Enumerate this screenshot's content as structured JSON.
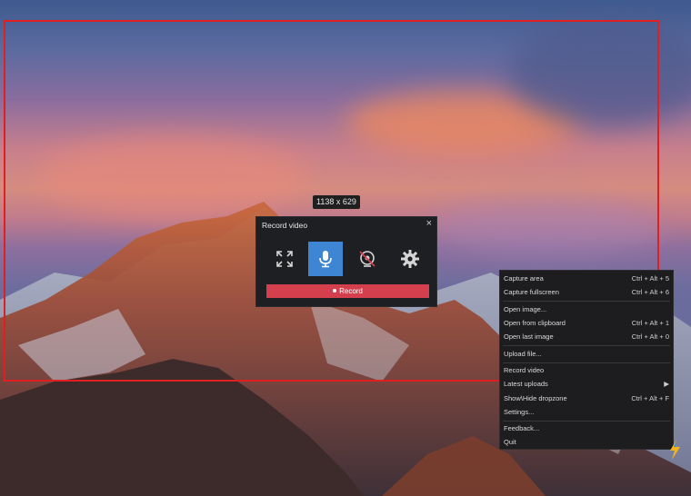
{
  "capture": {
    "size_label": "1138 x 629"
  },
  "record_panel": {
    "title": "Record video",
    "close_glyph": "×",
    "record_label": "Record",
    "buttons": [
      {
        "icon": "fullscreen-icon",
        "active": false
      },
      {
        "icon": "microphone-icon",
        "active": true
      },
      {
        "icon": "webcam-off-icon",
        "active": false
      },
      {
        "icon": "gear-icon",
        "active": false
      }
    ],
    "accent_color": "#3e86d3",
    "record_color": "#d43f4e"
  },
  "context_menu": {
    "items": [
      {
        "label": "Capture area",
        "shortcut": "Ctrl + Alt + 5"
      },
      {
        "label": "Capture fullscreen",
        "shortcut": "Ctrl + Alt + 6"
      },
      {
        "label": "Open image...",
        "shortcut": ""
      },
      {
        "label": "Open from clipboard",
        "shortcut": "Ctrl + Alt + 1"
      },
      {
        "label": "Open last image",
        "shortcut": "Ctrl + Alt + 0"
      },
      {
        "label": "Upload file...",
        "shortcut": ""
      },
      {
        "label": "Record video",
        "shortcut": ""
      },
      {
        "label": "Latest uploads",
        "shortcut": "▶"
      },
      {
        "label": "Show\\Hide dropzone",
        "shortcut": "Ctrl + Alt + F"
      },
      {
        "label": "Settings...",
        "shortcut": ""
      },
      {
        "label": "Feedback...",
        "shortcut": ""
      },
      {
        "label": "Quit",
        "shortcut": ""
      }
    ]
  },
  "selection_color": "#e02020"
}
